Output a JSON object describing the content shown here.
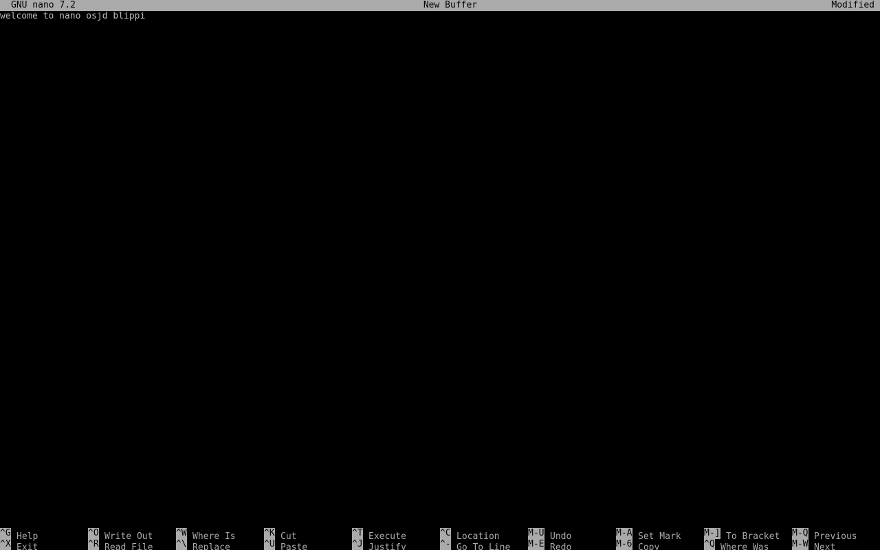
{
  "title_bar": {
    "version": "GNU nano 7.2",
    "buffer_name": "New Buffer",
    "state": "Modified"
  },
  "editor": {
    "lines": [
      "welcome to nano osjd blippi"
    ]
  },
  "shortcuts": {
    "row1": [
      {
        "key": "^G",
        "label": "Help"
      },
      {
        "key": "^O",
        "label": "Write Out"
      },
      {
        "key": "^W",
        "label": "Where Is"
      },
      {
        "key": "^K",
        "label": "Cut"
      },
      {
        "key": "^T",
        "label": "Execute"
      },
      {
        "key": "^C",
        "label": "Location"
      },
      {
        "key": "M-U",
        "label": "Undo"
      },
      {
        "key": "M-A",
        "label": "Set Mark"
      },
      {
        "key": "M-]",
        "label": "To Bracket"
      },
      {
        "key": "M-Q",
        "label": "Previous"
      }
    ],
    "row2": [
      {
        "key": "^X",
        "label": "Exit"
      },
      {
        "key": "^R",
        "label": "Read File"
      },
      {
        "key": "^\\",
        "label": "Replace"
      },
      {
        "key": "^U",
        "label": "Paste"
      },
      {
        "key": "^J",
        "label": "Justify"
      },
      {
        "key": "^-",
        "label": "Go To Line"
      },
      {
        "key": "M-E",
        "label": "Redo"
      },
      {
        "key": "M-6",
        "label": "Copy"
      },
      {
        "key": "^Q",
        "label": "Where Was"
      },
      {
        "key": "M-W",
        "label": "Next"
      }
    ]
  }
}
